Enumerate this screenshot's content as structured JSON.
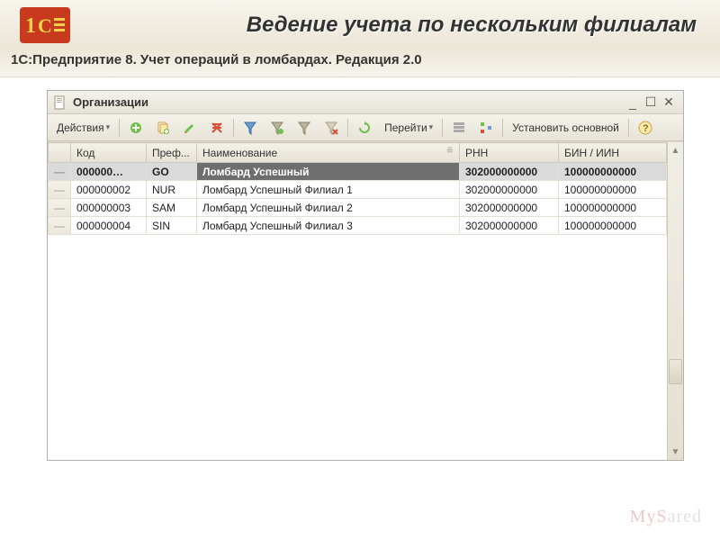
{
  "header": {
    "title": "Ведение учета по нескольким филиалам",
    "subtitle": "1С:Предприятие 8. Учет операций в ломбардах. Редакция 2.0"
  },
  "window": {
    "title": "Организации"
  },
  "toolbar": {
    "actions_label": "Действия",
    "goto_label": "Перейти",
    "set_main_label": "Установить основной"
  },
  "columns": {
    "code": "Код",
    "prefix": "Преф...",
    "name": "Наименование",
    "rnn": "РНН",
    "bin": "БИН / ИИН"
  },
  "rows": [
    {
      "code": "000000…",
      "prefix": "GO",
      "name": "Ломбард Успешный",
      "rnn": "302000000000",
      "bin": "100000000000",
      "selected": true
    },
    {
      "code": "000000002",
      "prefix": "NUR",
      "name": "Ломбард Успешный Филиал 1",
      "rnn": "302000000000",
      "bin": "100000000000",
      "selected": false
    },
    {
      "code": "000000003",
      "prefix": "SAM",
      "name": "Ломбард Успешный Филиал 2",
      "rnn": "302000000000",
      "bin": "100000000000",
      "selected": false
    },
    {
      "code": "000000004",
      "prefix": "SIN",
      "name": "Ломбард Успешный Филиал 3",
      "rnn": "302000000000",
      "bin": "100000000000",
      "selected": false
    }
  ],
  "footer": {
    "watermark_a": "MyS",
    "watermark_b": "ared"
  }
}
